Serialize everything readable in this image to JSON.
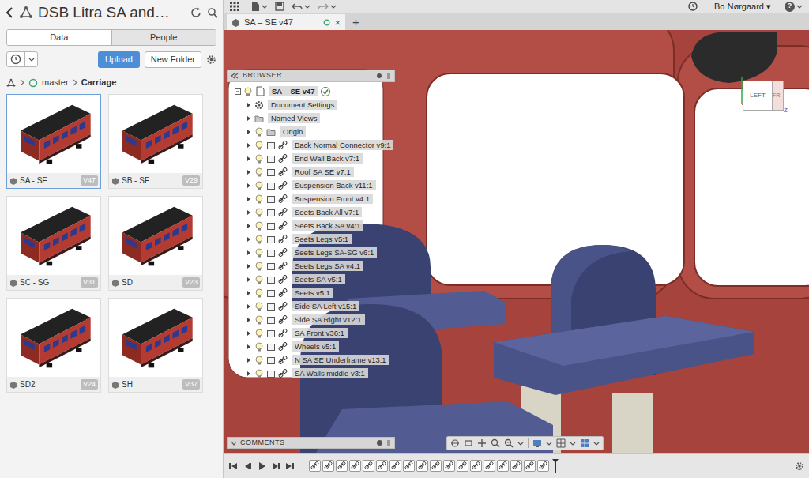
{
  "data_panel": {
    "title": "DSB Litra SA and…",
    "tabs": [
      {
        "label": "Data",
        "selected": true
      },
      {
        "label": "People",
        "selected": false
      }
    ],
    "upload": "Upload",
    "new_folder": "New Folder",
    "breadcrumb": [
      "master",
      "Carriage"
    ],
    "files": [
      {
        "name": "SA - SE",
        "version": "V47",
        "selected": true
      },
      {
        "name": "SB - SF",
        "version": "V29",
        "selected": false
      },
      {
        "name": "SC - SG",
        "version": "V31",
        "selected": false
      },
      {
        "name": "SD",
        "version": "V23",
        "selected": false
      },
      {
        "name": "SD2",
        "version": "V24",
        "selected": false
      },
      {
        "name": "SH",
        "version": "V37",
        "selected": false
      }
    ]
  },
  "top_bar": {
    "user": "Bo Nørgaard ▾",
    "help": "?"
  },
  "document_tabs": {
    "tabs": [
      {
        "label": "SA – SE v47",
        "selected": true,
        "close": "×"
      }
    ],
    "new_tab": "+"
  },
  "browser": {
    "title": "BROWSER",
    "items": [
      {
        "label": "SA – SE v47",
        "kind": "root"
      },
      {
        "label": "Document Settings",
        "kind": "settings"
      },
      {
        "label": "Named Views",
        "kind": "views"
      },
      {
        "label": "Origin",
        "kind": "folder"
      },
      {
        "label": "Back Normal Connector v9:1",
        "kind": "component"
      },
      {
        "label": "End Wall Back v7:1",
        "kind": "component"
      },
      {
        "label": "Roof SA SE v7:1",
        "kind": "component"
      },
      {
        "label": "Suspension Back v11:1",
        "kind": "component"
      },
      {
        "label": "Suspension Front v4:1",
        "kind": "component"
      },
      {
        "label": "Seets Back All v7:1",
        "kind": "component"
      },
      {
        "label": "Seets Back SA v4:1",
        "kind": "component"
      },
      {
        "label": "Seets Legs v5:1",
        "kind": "component"
      },
      {
        "label": "Seets Legs SA-SG v6:1",
        "kind": "component"
      },
      {
        "label": "Seets Legs SA v4:1",
        "kind": "component"
      },
      {
        "label": "Seets SA v5:1",
        "kind": "component"
      },
      {
        "label": "Seets v5:1",
        "kind": "component"
      },
      {
        "label": "Side SA Left v15:1",
        "kind": "component"
      },
      {
        "label": "Side SA Right v12:1",
        "kind": "component"
      },
      {
        "label": "SA Front v36:1",
        "kind": "component"
      },
      {
        "label": "Wheels v5:1",
        "kind": "component"
      },
      {
        "label": "N SA SE Underframe v13:1",
        "kind": "component"
      },
      {
        "label": "SA Walls middle v3:1",
        "kind": "component"
      }
    ]
  },
  "viewcube": {
    "left": "LEFT",
    "front": "FR",
    "axis": "Z"
  },
  "comments": {
    "title": "COMMENTS"
  },
  "timeline": {
    "features": [
      {
        "kind": "joint"
      },
      {
        "kind": "joint"
      },
      {
        "kind": "joint"
      },
      {
        "kind": "joint"
      },
      {
        "kind": "joint"
      },
      {
        "kind": "joint"
      },
      {
        "kind": "joint"
      },
      {
        "kind": "joint"
      },
      {
        "kind": "joint"
      },
      {
        "kind": "joint"
      },
      {
        "kind": "joint"
      },
      {
        "kind": "joint"
      },
      {
        "kind": "joint"
      },
      {
        "kind": "joint"
      },
      {
        "kind": "joint"
      },
      {
        "kind": "joint"
      },
      {
        "kind": "joint"
      },
      {
        "kind": "joint"
      }
    ]
  }
}
